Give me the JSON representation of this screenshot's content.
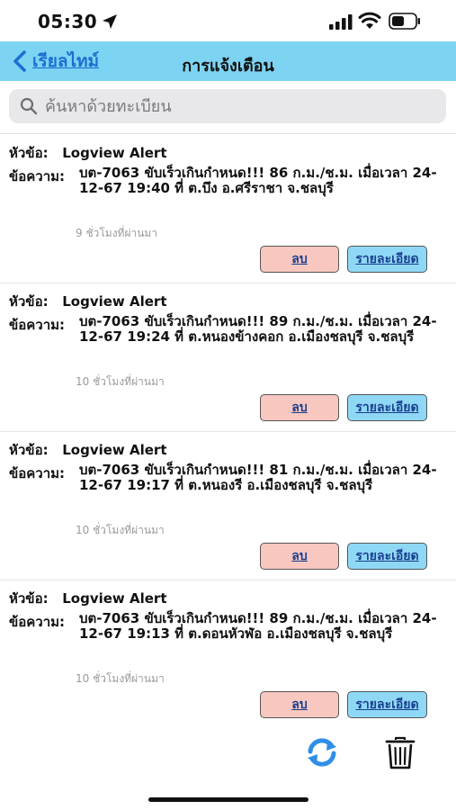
{
  "status_bar": {
    "time": "05:30"
  },
  "nav": {
    "back_label": "เรียลไทม์",
    "title": "การแจ้งเตือน"
  },
  "search": {
    "placeholder": "ค้นหาด้วยทะเบียน",
    "value": ""
  },
  "labels": {
    "subject": "หัวข้อ:",
    "message": "ข้อความ:",
    "delete": "ลบ",
    "detail": "รายละเอียด"
  },
  "alerts": [
    {
      "subject": "Logview Alert",
      "message": "บต-7063 ขับเร็วเกินกำหนด!!! 86 ก.ม./ช.ม. เมื่อเวลา 24-12-67 19:40 ที่ ต.บึง อ.ศรีราชา จ.ชลบุรี",
      "time_ago": "9 ชั่วโมงที่ผ่านมา"
    },
    {
      "subject": "Logview Alert",
      "message": "บต-7063 ขับเร็วเกินกำหนด!!! 89 ก.ม./ช.ม. เมื่อเวลา 24-12-67 19:24 ที่ ต.หนองข้างคอก อ.เมืองชลบุรี จ.ชลบุรี",
      "time_ago": "10 ชั่วโมงที่ผ่านมา"
    },
    {
      "subject": "Logview Alert",
      "message": "บต-7063 ขับเร็วเกินกำหนด!!! 81 ก.ม./ช.ม. เมื่อเวลา 24-12-67 19:17 ที่ ต.หนองรี อ.เมืองชลบุรี จ.ชลบุรี",
      "time_ago": "10 ชั่วโมงที่ผ่านมา"
    },
    {
      "subject": "Logview Alert",
      "message": "บต-7063 ขับเร็วเกินกำหนด!!! 89 ก.ม./ช.ม. เมื่อเวลา 24-12-67 19:13 ที่ ต.ดอนหัวฬ่อ อ.เมืองชลบุรี จ.ชลบุรี",
      "time_ago": "10 ชั่วโมงที่ผ่านมา"
    }
  ],
  "icons": {
    "location": "location-arrow-icon",
    "signal": "cellular-signal-icon",
    "wifi": "wifi-icon",
    "battery": "battery-icon",
    "back": "chevron-left-icon",
    "search": "search-icon",
    "refresh": "refresh-icon",
    "trash": "trash-icon"
  },
  "colors": {
    "nav_background": "#7dd3f2",
    "link_blue": "#1b6fd1",
    "delete_button": "#f7c7c0",
    "detail_button": "#8fd8f5",
    "refresh_blue": "#2f8fe6"
  }
}
